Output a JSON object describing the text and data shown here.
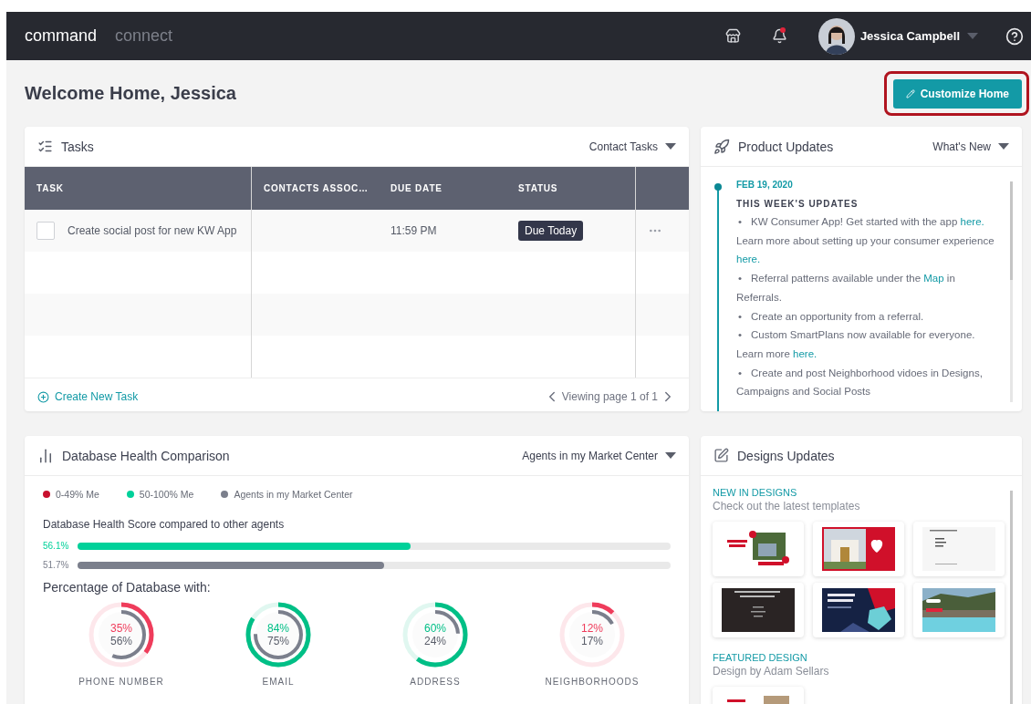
{
  "topbar": {
    "brand": "command",
    "section": "connect",
    "notifications_unread": true,
    "user": {
      "name": "Jessica Campbell"
    }
  },
  "page": {
    "title": "Welcome Home, Jessica",
    "customize_button": {
      "label": "Customize Home",
      "highlighted": true
    }
  },
  "tasks": {
    "title": "Tasks",
    "filter": "Contact Tasks",
    "columns": [
      "TASK",
      "CONTACTS ASSOC…",
      "DUE DATE",
      "STATUS"
    ],
    "rows": [
      {
        "checked": false,
        "task": "Create social post for new KW App",
        "due_date": "11:59 PM",
        "status": "Due Today"
      }
    ],
    "create_link": "Create New Task",
    "pager": "Viewing page 1 of 1"
  },
  "product_updates": {
    "title": "Product Updates",
    "filter": "What's New",
    "entries": [
      {
        "date": "FEB 19, 2020",
        "heading": "THIS WEEK'S UPDATES",
        "items": [
          {
            "bullet": "•",
            "segments": [
              {
                "text": "KW Consumer App! Get started with the app "
              },
              {
                "text": "here.",
                "link": true
              },
              {
                "text": " Learn more about setting up your consumer experience "
              },
              {
                "text": "here.",
                "link": true
              }
            ]
          },
          {
            "bullet": "•",
            "segments": [
              {
                "text": "Referral patterns available under the "
              },
              {
                "text": "Map",
                "link": true
              },
              {
                "text": " in Referrals."
              }
            ]
          },
          {
            "bullet": "•",
            "segments": [
              {
                "text": "Create an opportunity from a referral."
              }
            ]
          },
          {
            "bullet": "•",
            "segments": [
              {
                "text": "Custom SmartPlans now available for everyone. Learn more "
              },
              {
                "text": "here.",
                "link": true
              }
            ]
          },
          {
            "bullet": "•",
            "segments": [
              {
                "text": "Create and post Neighborhood vidoes in Designs, Campaigns and Social Posts"
              }
            ]
          }
        ]
      }
    ]
  },
  "database_health": {
    "title": "Database Health Comparison",
    "filter": "Agents in my Market Center",
    "legend": [
      {
        "label": "0-49% Me",
        "color": "#c8102e"
      },
      {
        "label": "50-100% Me",
        "color": "#00d19a"
      },
      {
        "label": "Agents in my Market Center",
        "color": "#7b7f8c"
      }
    ],
    "score_title": "Database Health Score compared to other agents",
    "bars": [
      {
        "reading": "56.1%",
        "level": 0.561,
        "color": "#00d19a"
      },
      {
        "reading": "51.7%",
        "level": 0.517,
        "color": "#7b7f8c"
      }
    ],
    "gauges_title": "Percentage of Database with:",
    "gauges": [
      {
        "label": "PHONE NUMBER",
        "me": {
          "reading": "35%",
          "level": 0.35,
          "color": "#ef3c5b"
        },
        "agents": {
          "reading": "56%",
          "level": 0.56
        }
      },
      {
        "label": "EMAIL",
        "me": {
          "reading": "84%",
          "level": 0.84,
          "color": "#00bf86"
        },
        "agents": {
          "reading": "75%",
          "level": 0.75
        }
      },
      {
        "label": "ADDRESS",
        "me": {
          "reading": "60%",
          "level": 0.6,
          "color": "#00bf86"
        },
        "agents": {
          "reading": "24%",
          "level": 0.24
        }
      },
      {
        "label": "NEIGHBORHOODS",
        "me": {
          "reading": "12%",
          "level": 0.12,
          "color": "#ef3c5b"
        },
        "agents": {
          "reading": "17%",
          "level": 0.17
        }
      }
    ]
  },
  "designs_updates": {
    "title": "Designs Updates",
    "sections": [
      {
        "heading": "NEW IN DESIGNS",
        "subtitle": "Check out the latest templates"
      },
      {
        "heading": "FEATURED DESIGN",
        "subtitle": "Design by Adam Sellars"
      }
    ]
  }
}
